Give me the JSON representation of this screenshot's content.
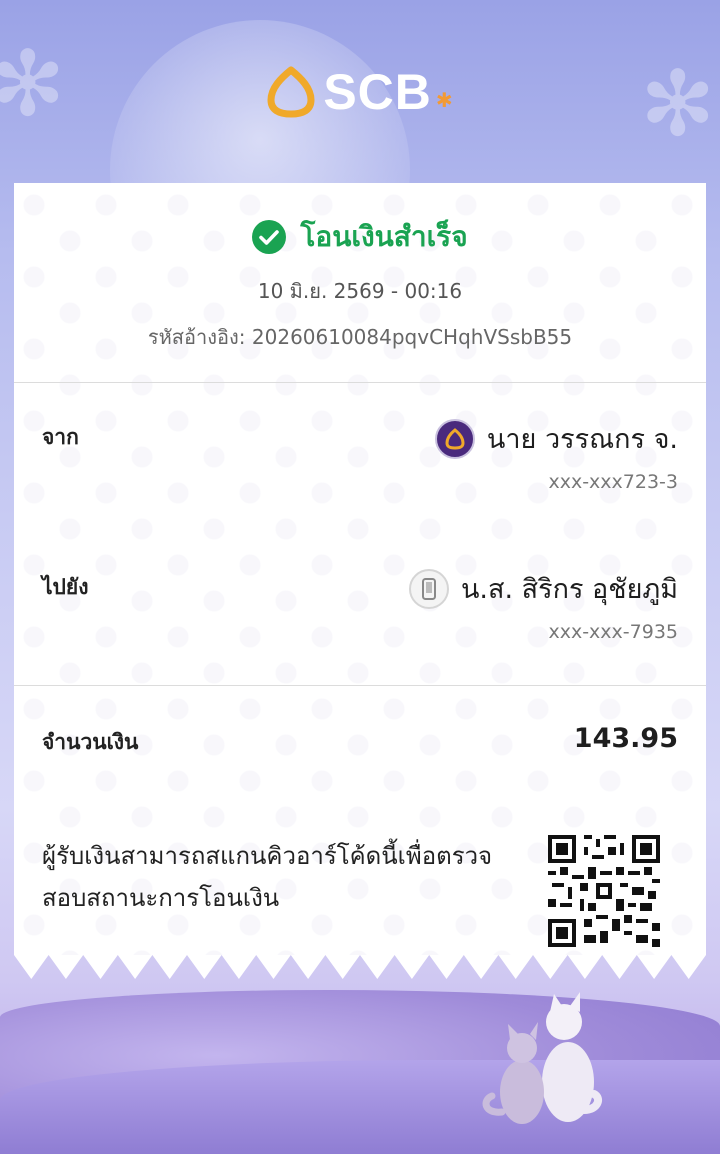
{
  "brand": {
    "name": "SCB",
    "icon": "scb-house-logo-icon"
  },
  "status": {
    "text": "โอนเงินสำเร็จ",
    "icon": "check-circle-icon",
    "color": "#1aa352"
  },
  "datetime": "10 มิ.ย. 2569 - 00:16",
  "reference": "รหัสอ้างอิง: 20260610084pqvCHqhVSsbB55",
  "from": {
    "label": "จาก",
    "name": "นาย วรรณกร จ.",
    "account": "xxx-xxx723-3",
    "icon": "scb-bank-icon"
  },
  "to": {
    "label": "ไปยัง",
    "name": "น.ส. สิริกร อุชัยภูมิ",
    "account": "xxx-xxx-7935",
    "icon": "phone-icon"
  },
  "amount": {
    "label": "จำนวนเงิน",
    "value": "143.95"
  },
  "qr": {
    "text": "ผู้รับเงินสามารถสแกนคิวอาร์โค้ดนี้เพื่อตรวจสอบสถานะการโอนเงิน",
    "icon": "qr-code-icon"
  },
  "colors": {
    "accent": "#4a2a7d",
    "success": "#1aa352",
    "logo_gold": "#f0a92a"
  }
}
